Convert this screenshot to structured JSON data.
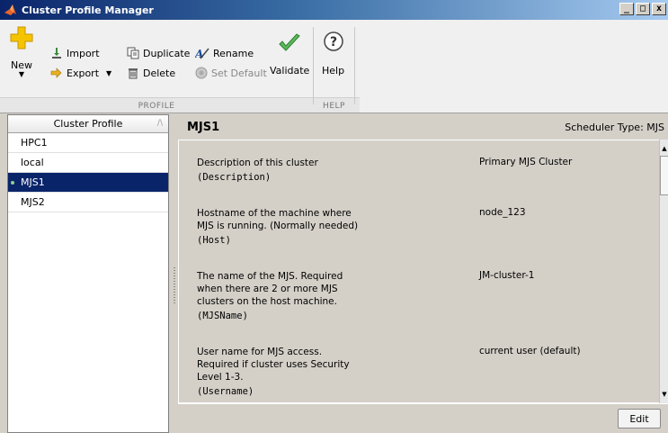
{
  "window": {
    "title": "Cluster Profile Manager",
    "controls": [
      "_",
      "□",
      "x"
    ]
  },
  "toolstrip": {
    "new_label": "New",
    "import_label": "Import",
    "export_label": "Export",
    "duplicate_label": "Duplicate",
    "delete_label": "Delete",
    "rename_label": "Rename",
    "set_default_label": "Set Default",
    "validate_label": "Validate",
    "help_label": "Help",
    "section_profile": "PROFILE",
    "section_help": "HELP"
  },
  "profiles": {
    "column_header": "Cluster Profile",
    "items": [
      "HPC1",
      "local",
      "MJS1",
      "MJS2"
    ],
    "selected_index": 2
  },
  "details": {
    "profile_name": "MJS1",
    "scheduler_type": "Scheduler Type: MJS",
    "properties": [
      {
        "desc": "Description of this cluster",
        "key": "(Description)",
        "value": "Primary MJS Cluster"
      },
      {
        "desc": "Hostname of the machine where MJS is running. (Normally needed)",
        "key": "(Host)",
        "value": "node_123"
      },
      {
        "desc": "The name of the MJS. Required when there are 2 or more MJS clusters on the host machine.",
        "key": "(MJSName)",
        "value": "JM-cluster-1"
      },
      {
        "desc": "User name for MJS access. Required if cluster uses Security Level 1-3.",
        "key": "(Username)",
        "value": "current user (default)"
      }
    ],
    "edit_label": "Edit"
  },
  "colors": {
    "selection": "#0a246a",
    "titlebar_start": "#0a246a",
    "validate_check": "#5cb85c",
    "new_plus": "#f5c400"
  }
}
